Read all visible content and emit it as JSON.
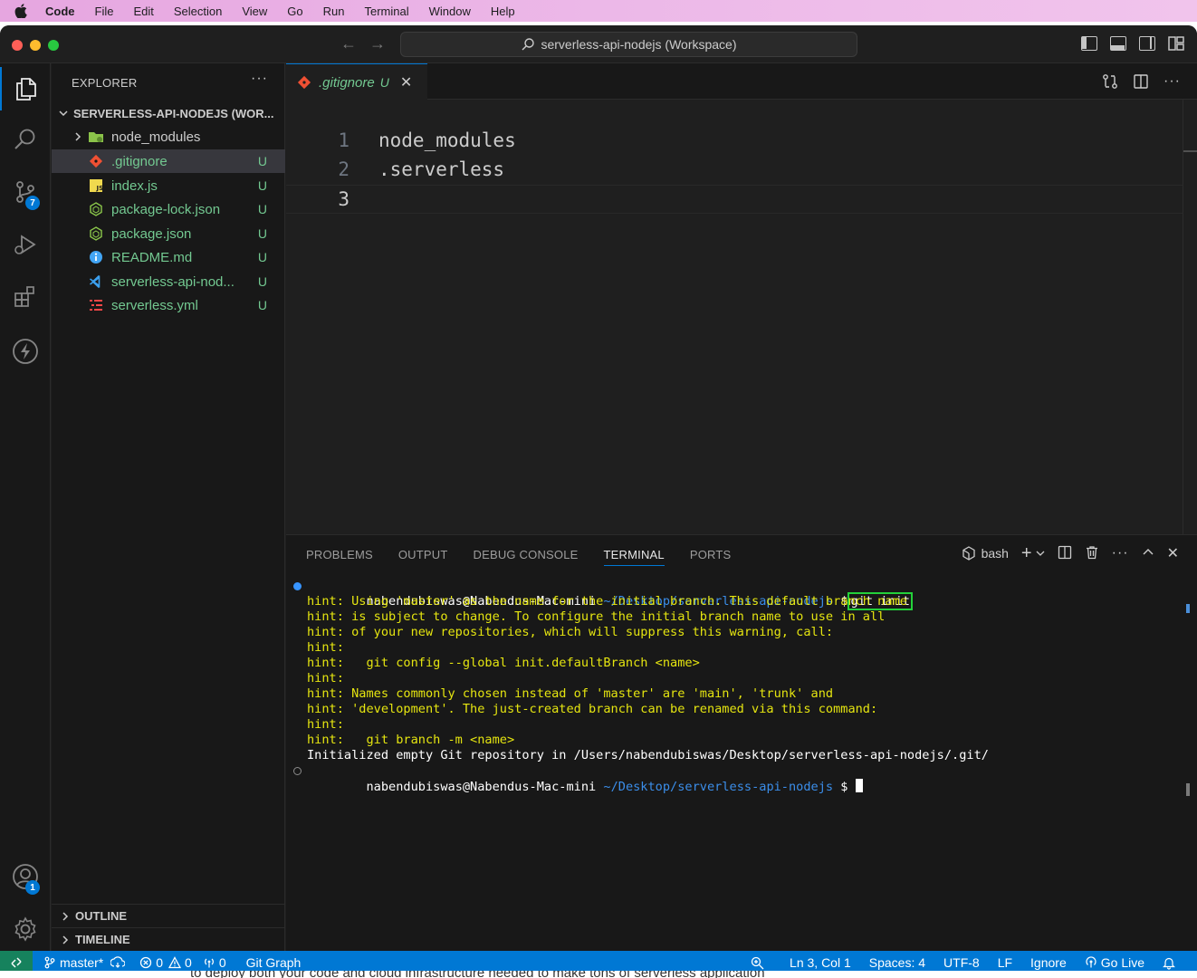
{
  "menubar": {
    "app": "Code",
    "items": [
      "File",
      "Edit",
      "Selection",
      "View",
      "Go",
      "Run",
      "Terminal",
      "Window",
      "Help"
    ]
  },
  "titlebar": {
    "search_text": "serverless-api-nodejs (Workspace)"
  },
  "activity": {
    "scm_badge": "7",
    "account_badge": "1"
  },
  "sidebar": {
    "title": "EXPLORER",
    "more": "···",
    "workspace": "SERVERLESS-API-NODEJS (WOR...",
    "files": [
      {
        "name": "node_modules",
        "status": "",
        "icon": "folder-icon"
      },
      {
        "name": ".gitignore",
        "status": "U",
        "icon": "git-icon"
      },
      {
        "name": "index.js",
        "status": "U",
        "icon": "js-icon"
      },
      {
        "name": "package-lock.json",
        "status": "U",
        "icon": "nodejs-icon"
      },
      {
        "name": "package.json",
        "status": "U",
        "icon": "nodejs-icon"
      },
      {
        "name": "README.md",
        "status": "U",
        "icon": "info-icon"
      },
      {
        "name": "serverless-api-nod...",
        "status": "U",
        "icon": "vscode-icon"
      },
      {
        "name": "serverless.yml",
        "status": "U",
        "icon": "yaml-icon"
      }
    ],
    "outline": "OUTLINE",
    "timeline": "TIMELINE"
  },
  "editor": {
    "tab": {
      "name": ".gitignore",
      "status": "U"
    },
    "lines": [
      {
        "num": "1",
        "text": "node_modules"
      },
      {
        "num": "2",
        "text": ".serverless"
      },
      {
        "num": "3",
        "text": ""
      }
    ]
  },
  "panel": {
    "tabs": [
      "PROBLEMS",
      "OUTPUT",
      "DEBUG CONSOLE",
      "TERMINAL",
      "PORTS"
    ],
    "active_tab": "TERMINAL",
    "shell": "bash",
    "prompt_user": "nabendubiswas@Nabendus-Mac-mini",
    "prompt_path": "~/Desktop/serverless-api-nodejs",
    "prompt_symbol": "$",
    "command": "git init",
    "hints": [
      "hint: Using 'master' as the name for the initial branch. This default branch name",
      "hint: is subject to change. To configure the initial branch name to use in all",
      "hint: of your new repositories, which will suppress this warning, call:",
      "hint:",
      "hint:   git config --global init.defaultBranch <name>",
      "hint:",
      "hint: Names commonly chosen instead of 'master' are 'main', 'trunk' and",
      "hint: 'development'. The just-created branch can be renamed via this command:",
      "hint:",
      "hint:   git branch -m <name>"
    ],
    "initialized": "Initialized empty Git repository in /Users/nabendubiswas/Desktop/serverless-api-nodejs/.git/"
  },
  "statusbar": {
    "branch": "master*",
    "errors": "0",
    "warnings": "0",
    "ports": "0",
    "git_graph": "Git Graph",
    "position": "Ln 3, Col 1",
    "spaces": "Spaces: 4",
    "encoding": "UTF-8",
    "eol": "LF",
    "language": "Ignore",
    "go_live": "Go Live"
  },
  "underlay_text": "to deploy both your code and cloud infrastructure needed to make tons of serverless application"
}
